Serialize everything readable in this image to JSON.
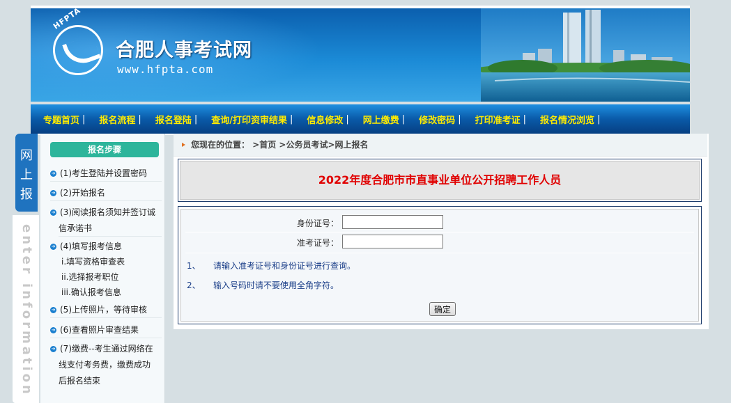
{
  "header": {
    "logo_text": "HFPTA",
    "site_title": "合肥人事考试网",
    "site_url": "www.hfpta.com"
  },
  "nav": {
    "items": [
      {
        "label": "专题首页"
      },
      {
        "label": "报名流程"
      },
      {
        "label": "报名登陆"
      },
      {
        "label": "查询/打印资审结果"
      },
      {
        "label": "信息修改"
      },
      {
        "label": "网上缴费"
      },
      {
        "label": "修改密码"
      },
      {
        "label": "打印准考证"
      },
      {
        "label": "报名情况浏览"
      }
    ],
    "separator": "|"
  },
  "side_tab": {
    "label_lines": [
      "网",
      "上",
      "报"
    ],
    "watermark": "enter information"
  },
  "steps": {
    "title": "报名步骤",
    "items": [
      "(1)考生登陆并设置密码",
      "(2)开始报名",
      "(3)阅读报名须知并签订诚",
      "信承诺书",
      "(4)填写报考信息",
      "(5)上传照片，等待审核",
      "(6)查看照片审查结果",
      "(7)缴费--考生通过网络在",
      "线支付考务费，缴费成功",
      "后报名结束"
    ],
    "substeps": [
      "i.填写资格审查表",
      "ii.选择报考职位",
      "iii.确认报考信息"
    ]
  },
  "breadcrumb": {
    "prefix": "您现在的位置：",
    "path": ">首页 >公务员考试>网上报名"
  },
  "main": {
    "heading": "2022年度合肥市市直事业单位公开招聘工作人员",
    "form": {
      "id_label": "身份证号：",
      "id_value": "",
      "ticket_label": "准考证号：",
      "ticket_value": "",
      "notes": [
        {
          "num": "1、",
          "text": "请输入准考证号和身份证号进行查询。"
        },
        {
          "num": "2、",
          "text": "输入号码时请不要使用全角字符。"
        }
      ],
      "submit_label": "确定"
    }
  },
  "colors": {
    "nav_text": "#ffeb00",
    "heading": "#e00000",
    "steps_title_bg": "#2db59b",
    "notes": "#1a3e88"
  }
}
